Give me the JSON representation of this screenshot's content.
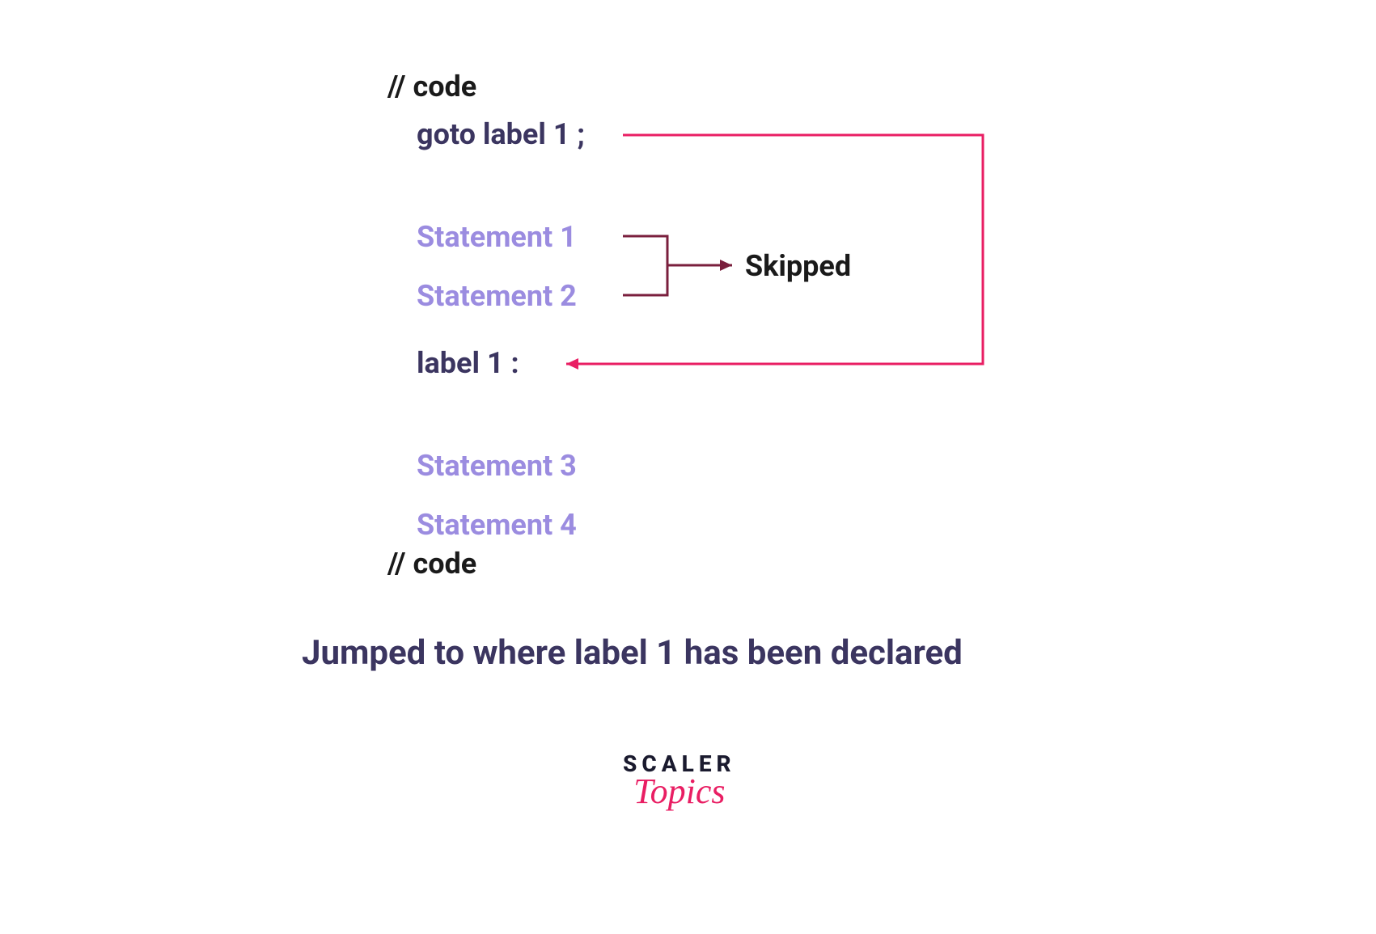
{
  "code": {
    "comment_top": "// code",
    "goto_statement": "goto label 1 ;",
    "statement_1": "Statement 1",
    "statement_2": "Statement 2",
    "label_declaration": "label 1 :",
    "statement_3": "Statement 3",
    "statement_4": "Statement 4",
    "comment_bottom": "// code"
  },
  "annotations": {
    "skipped": "Skipped"
  },
  "caption": "Jumped to where label 1 has been declared",
  "logo": {
    "line1": "SCALER",
    "line2": "Topics"
  },
  "colors": {
    "pink_arrow": "#e91e63",
    "maroon_arrow": "#7a1f3d",
    "purple_statement": "#9b8ce0",
    "dark_text": "#3b3560"
  }
}
